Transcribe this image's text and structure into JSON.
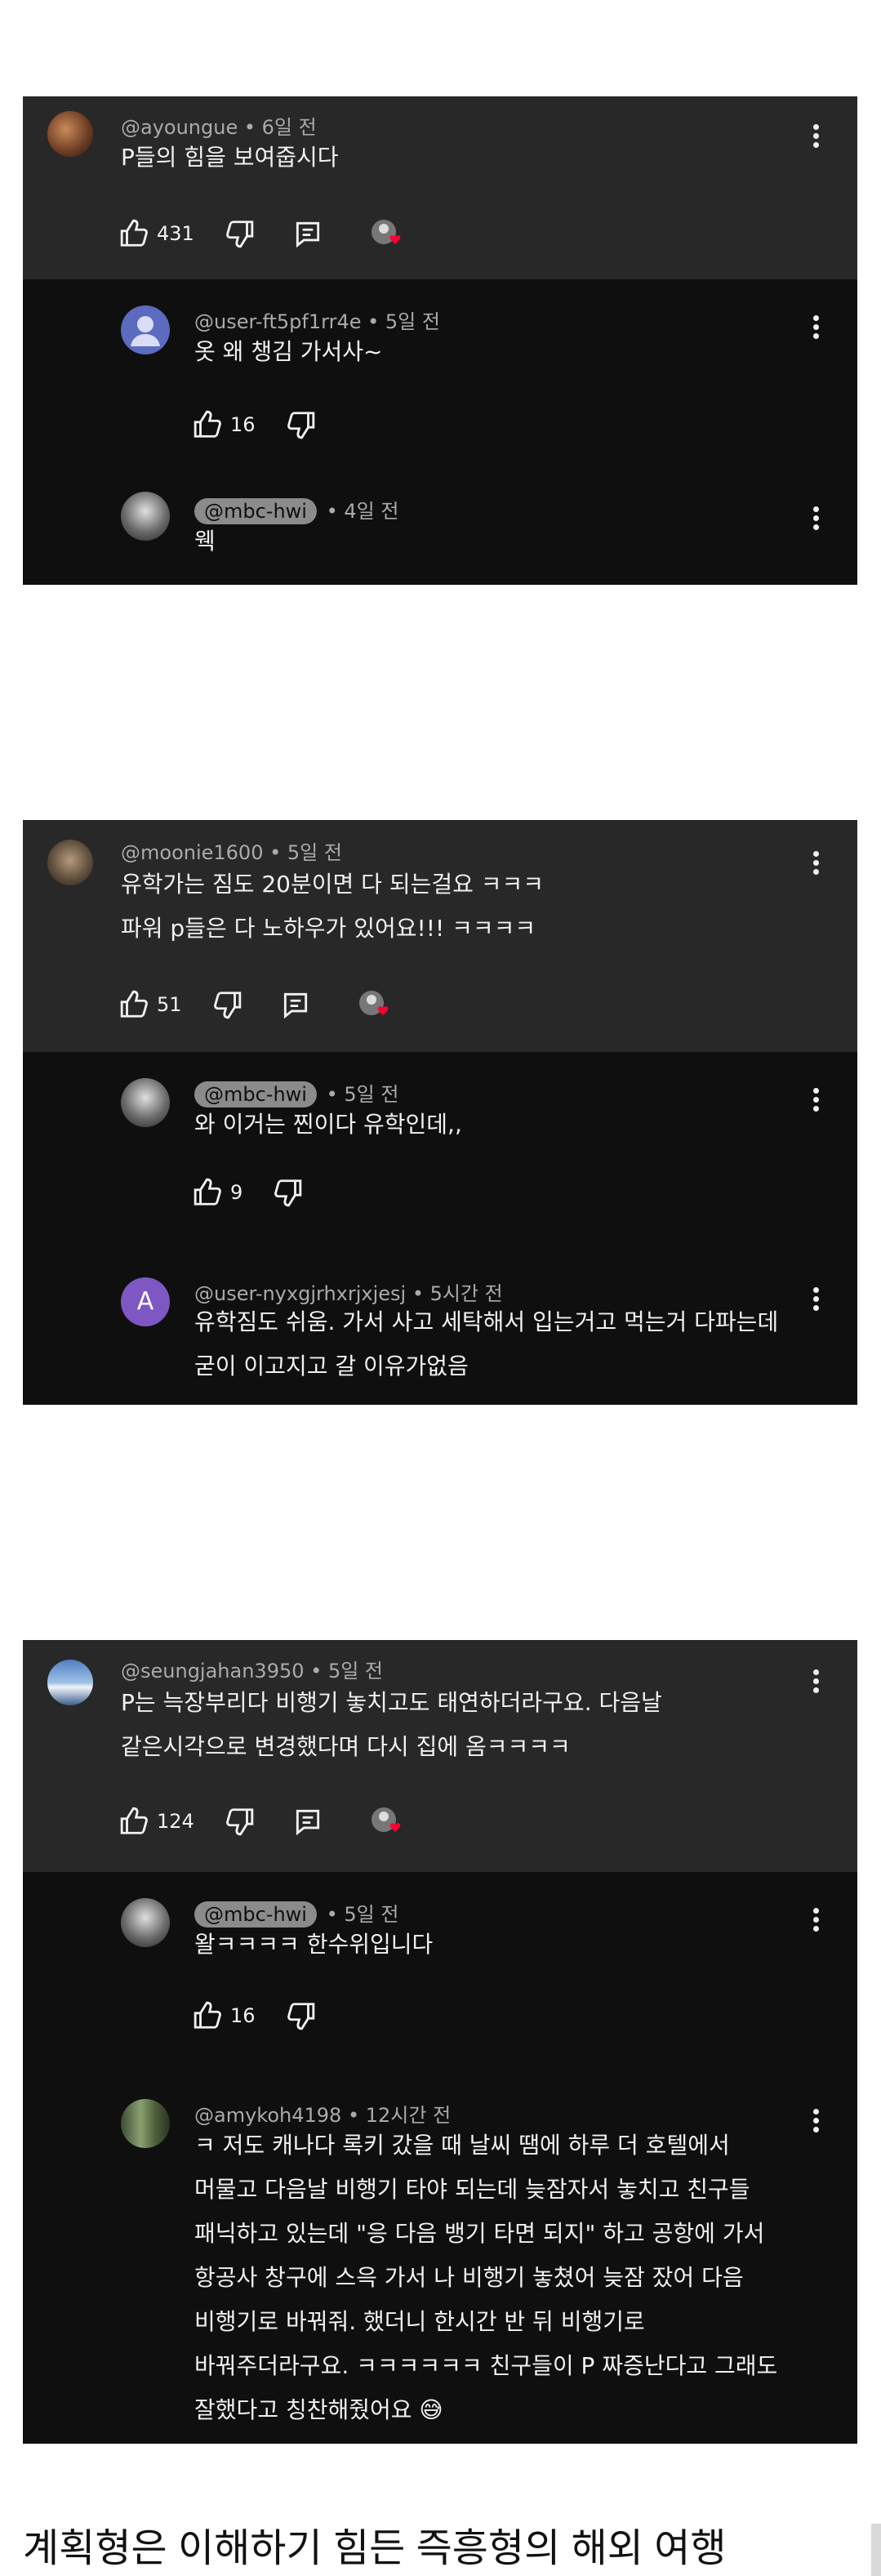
{
  "card1": {
    "top": {
      "handle": "@ayoungue",
      "time": "• 6일 전",
      "lines": [
        "P들의 힘을 보여줍시다"
      ],
      "likes": "431"
    },
    "replies": [
      {
        "handle": "@user-ft5pf1rr4e",
        "time": "• 5일 전",
        "lines": [
          "옷 왜 챙김 가서사~"
        ],
        "likes": "16",
        "creator": false
      },
      {
        "handle": "@mbc-hwi",
        "time": "• 4일 전",
        "lines": [
          "웩"
        ],
        "likes": "",
        "creator": true
      }
    ]
  },
  "card2": {
    "top": {
      "handle": "@moonie1600",
      "time": "• 5일 전",
      "lines": [
        "유학가는 짐도 20분이면 다 되는걸요 ㅋㅋㅋ",
        "파워 p들은 다 노하우가 있어요!!! ㅋㅋㅋㅋ"
      ],
      "likes": "51"
    },
    "replies": [
      {
        "handle": "@mbc-hwi",
        "time": "• 5일 전",
        "lines": [
          "와 이거는 찐이다 유학인데,,"
        ],
        "likes": "9",
        "creator": true
      },
      {
        "handle": "@user-nyxgjrhxrjxjesj",
        "time": "• 5시간 전",
        "lines": [
          "유학짐도 쉬움. 가서 사고 세탁해서 입는거고 먹는거 다파는데",
          "굳이 이고지고 갈 이유가없음"
        ],
        "likes": "",
        "creator": false,
        "avatar_letter": "A"
      }
    ]
  },
  "card3": {
    "top": {
      "handle": "@seungjahan3950",
      "time": "• 5일 전",
      "lines": [
        "P는 늑장부리다 비행기 놓치고도 태연하더라구요. 다음날",
        "같은시각으로 변경했다며 다시 집에 옴ㅋㅋㅋㅋ"
      ],
      "likes": "124"
    },
    "replies": [
      {
        "handle": "@mbc-hwi",
        "time": "• 5일 전",
        "lines": [
          "왈ㅋㅋㅋㅋ 한수위입니다"
        ],
        "likes": "16",
        "creator": true
      },
      {
        "handle": "@amykoh4198",
        "time": "• 12시간 전",
        "lines": [
          "ㅋ 저도 캐나다 록키 갔을 때 날씨 땜에 하루 더 호텔에서",
          "머물고 다음날 비행기 타야 되는데 늦잠자서 놓치고 친구들",
          "패닉하고 있는데 \"응 다음 뱅기 타면 되지\" 하고 공항에 가서",
          "항공사 창구에 스윽 가서 나 비행기 놓쳤어 늦잠 잤어 다음",
          "비행기로 바꿔줘. 했더니 한시간 반 뒤 비행기로",
          "바꿔주더라구요. ㅋㅋㅋㅋㅋㅋ 친구들이 P 짜증난다고 그래도",
          "잘했다고 칭찬해줬어요 😅"
        ],
        "likes": "",
        "creator": false
      }
    ]
  },
  "caption": "계획형은 이해하기 힘든 즉흥형의 해외 여행",
  "colors": {
    "card_bg": "#0f0f0f",
    "top_bg": "#282828",
    "text": "#f1f1f1",
    "meta": "#aaaaaa",
    "heart": "#ff0033"
  }
}
